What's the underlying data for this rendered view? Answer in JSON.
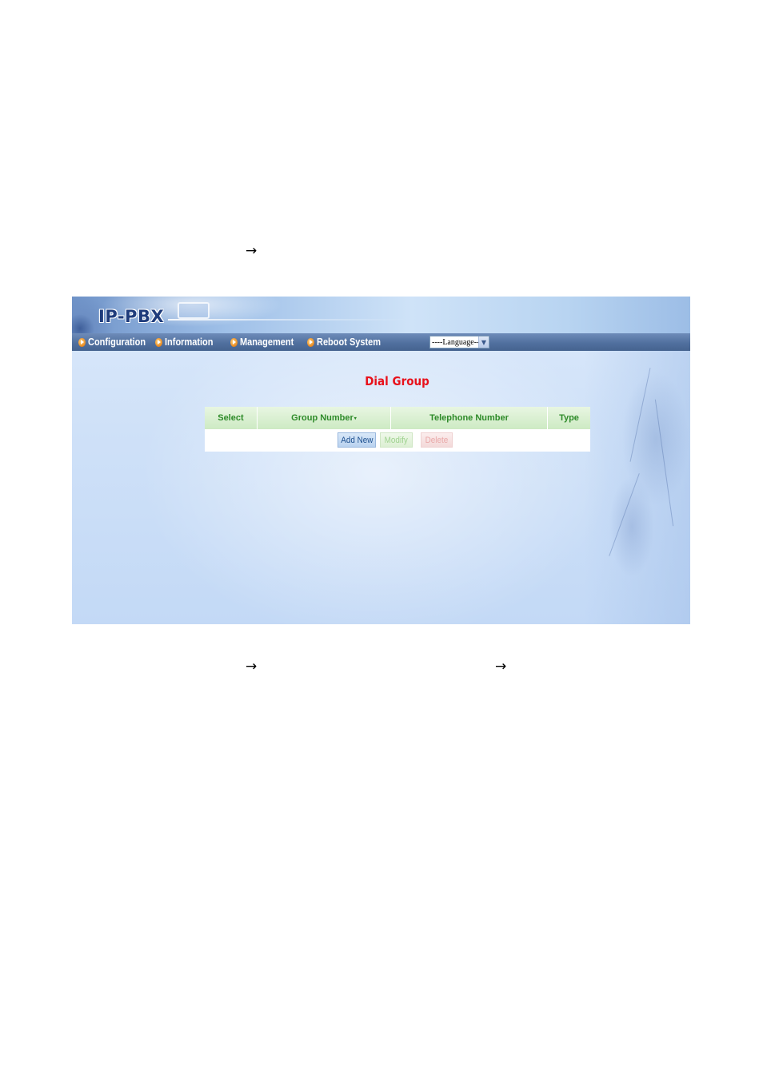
{
  "document": {
    "arrows": [
      "→",
      "→",
      "→"
    ]
  },
  "app": {
    "logo_text": "IP-PBX"
  },
  "nav": {
    "items": [
      {
        "label": "Configuration"
      },
      {
        "label": "Information"
      },
      {
        "label": "Management"
      },
      {
        "label": "Reboot System"
      }
    ],
    "language_select": {
      "selected": "----Language----"
    }
  },
  "page": {
    "title": "Dial Group"
  },
  "table": {
    "columns": [
      "Select",
      "Group Number",
      "Telephone Number",
      "Type"
    ],
    "sort_indicator": "▾",
    "rows": []
  },
  "actions": {
    "add_label": "Add New",
    "modify_label": "Modify",
    "delete_label": "Delete"
  }
}
